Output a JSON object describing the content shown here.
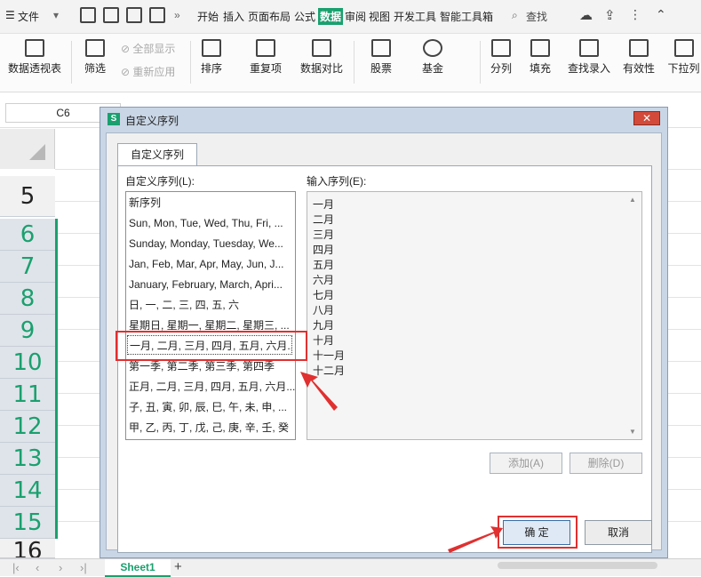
{
  "menubar": {
    "file": "文件",
    "tabs": [
      "开始",
      "插入",
      "页面布局",
      "公式",
      "数据",
      "审阅",
      "视图",
      "开发工具",
      "智能工具箱"
    ],
    "active_tab": "数据",
    "search": "查找",
    "more": "»"
  },
  "ribbon": {
    "pivot": "数据透视表",
    "filter": "筛选",
    "show_all": "全部显示",
    "reapply": "重新应用",
    "sort": "排序",
    "duplicates": "重复项",
    "compare": "数据对比",
    "stocks": "股票",
    "funds": "基金",
    "split": "分列",
    "fill": "填充",
    "lookup": "查找录入",
    "validity": "有效性",
    "dropdown": "下拉列"
  },
  "formula_bar": {
    "cell_ref": "C6"
  },
  "sheet": {
    "rows": [
      "5",
      "6",
      "7",
      "8",
      "9",
      "10",
      "11",
      "12",
      "13",
      "14",
      "15",
      "16"
    ],
    "tab": "Sheet1",
    "add": "+"
  },
  "dialog": {
    "title": "自定义序列",
    "tab": "自定义序列",
    "list_label": "自定义序列(L):",
    "input_label": "输入序列(E):",
    "list_items": [
      "新序列",
      "Sun, Mon, Tue, Wed, Thu, Fri, ...",
      "Sunday, Monday, Tuesday, We...",
      "Jan, Feb, Mar, Apr, May, Jun, J...",
      "January, February, March, Apri...",
      "日, 一, 二, 三, 四, 五, 六",
      "星期日, 星期一, 星期二, 星期三, ...",
      "一月, 二月, 三月, 四月, 五月, 六月...",
      "第一季, 第二季, 第三季, 第四季",
      "正月, 二月, 三月, 四月, 五月, 六月...",
      "子, 丑, 寅, 卯, 辰, 巳, 午, 未, 申, ...",
      "甲, 乙, 丙, 丁, 戊, 己, 庚, 辛, 壬, 癸"
    ],
    "selected_index": 7,
    "input_lines": [
      "一月",
      "二月",
      "三月",
      "四月",
      "五月",
      "六月",
      "七月",
      "八月",
      "九月",
      "十月",
      "十一月",
      "十二月"
    ],
    "add_button": "添加(A)",
    "delete_button": "删除(D)",
    "ok_button": "确 定",
    "cancel_button": "取消"
  },
  "colors": {
    "accent": "#1aa06e",
    "highlight": "#e03030"
  }
}
